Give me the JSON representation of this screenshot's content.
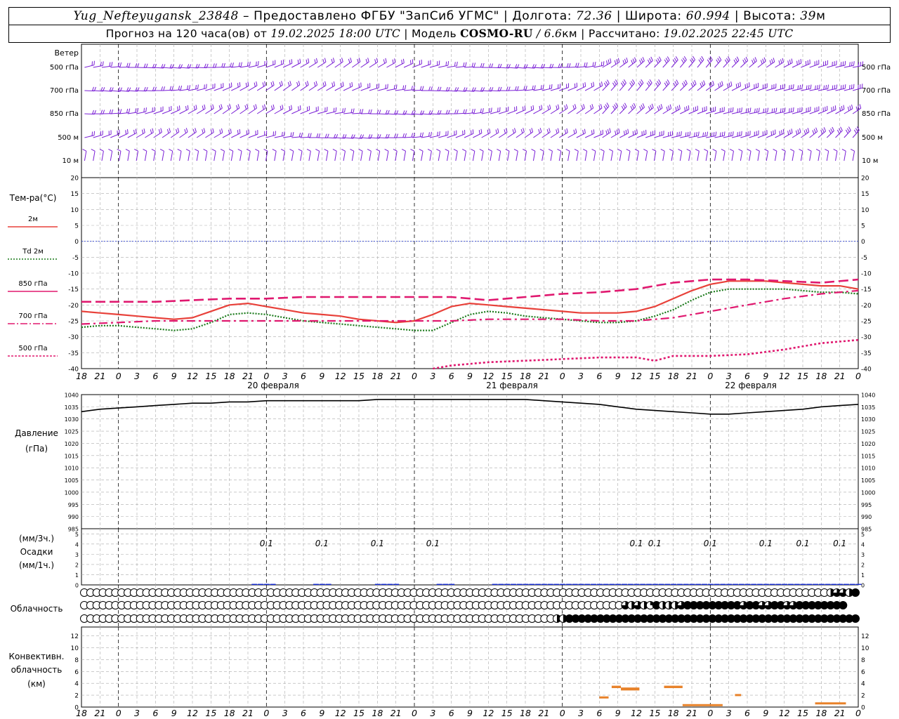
{
  "header": {
    "station": "Yug_Nefteyugansk_23848",
    "provided_prefix": " – Предоставлено ФГБУ \"ЗапСиб УГМС\" | Долгота: ",
    "longitude": "72.36",
    "lat_label": " | Широта: ",
    "latitude": "60.994",
    "alt_label": " | Высота: ",
    "altitude": "39",
    "altitude_unit": "м",
    "forecast_prefix": "Прогноз на 120 часа(ов) от ",
    "forecast_start": "19.02.2025 18:00 UTC",
    "model_label": "  | Модель ",
    "model": "COSMO-RU",
    "resolution": " / 6.6",
    "resolution_unit": "км",
    "computed_label": " | Рассчитано: ",
    "computed": "19.02.2025 22:45 UTC"
  },
  "wind_panel": {
    "title": "Ветер",
    "levels": [
      "500 гПа",
      "700 гПа",
      "850 гПа",
      "500 м",
      "10 м"
    ],
    "barb_color": "#7a1fd6"
  },
  "time_axis": {
    "hour_labels": [
      "18",
      "21",
      "0",
      "3",
      "6",
      "9",
      "12",
      "15",
      "18",
      "21",
      "0",
      "3",
      "6",
      "9",
      "12",
      "15",
      "18",
      "21",
      "0",
      "3",
      "6",
      "9",
      "12",
      "15",
      "18",
      "21",
      "0",
      "3",
      "6",
      "9",
      "12",
      "15",
      "18",
      "21",
      "0",
      "3",
      "6",
      "9",
      "12",
      "15",
      "18",
      "21",
      "0"
    ],
    "day_labels": [
      "20 февраля",
      "21 февраля",
      "22 февраля"
    ]
  },
  "temp_panel": {
    "title": "Тем-ра(°C)",
    "legend": [
      {
        "label": "2м",
        "color": "#e8413a",
        "dash": "solid"
      },
      {
        "label": "Td 2м",
        "color": "#1a7a1a",
        "dash": "dotted"
      },
      {
        "label": "850 гПа",
        "color": "#e0186f",
        "dash": "long"
      },
      {
        "label": "700 гПа",
        "color": "#e0186f",
        "dash": "dashdot"
      },
      {
        "label": "500 гПа",
        "color": "#e0186f",
        "dash": "short"
      }
    ],
    "y_ticks": [
      "20",
      "15",
      "10",
      "5",
      "0",
      "-5",
      "-10",
      "-15",
      "-20",
      "-25",
      "-30",
      "-35",
      "-40"
    ]
  },
  "pressure_panel": {
    "title": "Давление",
    "unit": "(гПа)",
    "y_ticks": [
      "1040",
      "1035",
      "1030",
      "1025",
      "1020",
      "1015",
      "1010",
      "1005",
      "1000",
      "995",
      "990",
      "985"
    ]
  },
  "precip_panel": {
    "unit_3h": "(мм/3ч.)",
    "title": "Осадки",
    "unit_1h": "(мм/1ч.)",
    "y_ticks": [
      "5",
      "4",
      "3",
      "2",
      "1",
      "0"
    ],
    "labels": [
      {
        "hour": 30,
        "text": "0.1"
      },
      {
        "hour": 39,
        "text": "0.1"
      },
      {
        "hour": 48,
        "text": "0.1"
      },
      {
        "hour": 57,
        "text": "0.1"
      },
      {
        "hour": 90,
        "text": "0.1"
      },
      {
        "hour": 93,
        "text": "0.1"
      },
      {
        "hour": 102,
        "text": "0.1"
      },
      {
        "hour": 111,
        "text": "0.1"
      },
      {
        "hour": 117,
        "text": "0.1"
      },
      {
        "hour": 123,
        "text": "0.1"
      }
    ],
    "bar_color": "#1a2fd6"
  },
  "cloud_panel": {
    "title": "Облачность"
  },
  "conv_panel": {
    "title_1": "Конвективн.",
    "title_2": "облачность",
    "unit": "(км)",
    "y_ticks": [
      "12",
      "10",
      "8",
      "6",
      "4",
      "2",
      "0"
    ],
    "bar_color": "#e8822a"
  },
  "chart_data": {
    "type": "line",
    "x_unit": "hours from 19.02.2025 18:00 UTC",
    "xlim": [
      0,
      126
    ],
    "series": [
      {
        "name": "2м",
        "panel": "temperature",
        "unit": "°C",
        "x": [
          0,
          3,
          6,
          9,
          12,
          15,
          18,
          21,
          24,
          27,
          30,
          33,
          36,
          39,
          42,
          45,
          48,
          51,
          54,
          57,
          60,
          63,
          66,
          69,
          72,
          75,
          78,
          81,
          84,
          87,
          90,
          93,
          96,
          99,
          102,
          105,
          108,
          111,
          114,
          117,
          120,
          123,
          126
        ],
        "values": [
          -22,
          -22.5,
          -23,
          -23.5,
          -24,
          -24.5,
          -24,
          -22,
          -20,
          -19.5,
          -20.5,
          -21.5,
          -22.5,
          -23,
          -23.5,
          -24.5,
          -25,
          -25.5,
          -25,
          -23,
          -20.5,
          -19.5,
          -20,
          -20.5,
          -21,
          -21.5,
          -22,
          -22.5,
          -22.5,
          -22.5,
          -22,
          -20.5,
          -18,
          -15.5,
          -13.5,
          -12.5,
          -12.5,
          -12.5,
          -13,
          -13.5,
          -14,
          -14,
          -15
        ]
      },
      {
        "name": "Td 2м",
        "panel": "temperature",
        "unit": "°C",
        "x": [
          0,
          3,
          6,
          9,
          12,
          15,
          18,
          21,
          24,
          27,
          30,
          33,
          36,
          39,
          42,
          45,
          48,
          51,
          54,
          57,
          60,
          63,
          66,
          69,
          72,
          75,
          78,
          81,
          84,
          87,
          90,
          93,
          96,
          99,
          102,
          105,
          108,
          111,
          114,
          117,
          120,
          123,
          126
        ],
        "values": [
          -27,
          -26.5,
          -26.5,
          -27,
          -27.5,
          -28,
          -27.5,
          -25.5,
          -23,
          -22.5,
          -23,
          -24,
          -25,
          -25.5,
          -26,
          -26.5,
          -27,
          -27.5,
          -28,
          -28,
          -25.5,
          -23,
          -22,
          -22.5,
          -23.5,
          -24,
          -24.5,
          -25,
          -25.5,
          -25.5,
          -25,
          -23.5,
          -21.5,
          -18.5,
          -16,
          -15,
          -15,
          -15,
          -15,
          -15.5,
          -16,
          -16,
          -16.5
        ]
      },
      {
        "name": "850 гПа",
        "panel": "temperature",
        "unit": "°C",
        "x": [
          0,
          6,
          12,
          18,
          24,
          30,
          36,
          42,
          48,
          54,
          60,
          66,
          72,
          78,
          84,
          90,
          96,
          102,
          108,
          114,
          120,
          126
        ],
        "values": [
          -19,
          -19,
          -19,
          -18.5,
          -18,
          -18,
          -17.5,
          -17.5,
          -17.5,
          -17.5,
          -17.5,
          -18.5,
          -17.5,
          -16.5,
          -16,
          -15,
          -13,
          -12,
          -12,
          -12.5,
          -13,
          -12
        ]
      },
      {
        "name": "700 гПа",
        "panel": "temperature",
        "unit": "°C",
        "x": [
          0,
          6,
          12,
          18,
          24,
          30,
          36,
          42,
          48,
          54,
          60,
          66,
          72,
          78,
          84,
          90,
          96,
          102,
          108,
          114,
          120,
          126
        ],
        "values": [
          -26,
          -25.5,
          -25,
          -25,
          -25,
          -25,
          -25,
          -25,
          -25,
          -25,
          -25,
          -24.5,
          -24.5,
          -24.5,
          -25,
          -25,
          -24,
          -22,
          -20,
          -18,
          -16.5,
          -15.5
        ]
      },
      {
        "name": "500 гПа",
        "panel": "temperature",
        "unit": "°C",
        "x": [
          57,
          60,
          66,
          72,
          78,
          84,
          90,
          93,
          96,
          102,
          108,
          114,
          120,
          126
        ],
        "values": [
          -40,
          -39,
          -38,
          -37.5,
          -37,
          -36.5,
          -36.5,
          -37.5,
          -36,
          -36,
          -35.5,
          -34,
          -32,
          -31
        ]
      },
      {
        "name": "Давление",
        "panel": "pressure",
        "unit": "гПа",
        "x": [
          0,
          3,
          6,
          9,
          12,
          15,
          18,
          21,
          24,
          27,
          30,
          33,
          36,
          39,
          42,
          45,
          48,
          51,
          54,
          57,
          60,
          63,
          66,
          69,
          72,
          75,
          78,
          81,
          84,
          87,
          90,
          93,
          96,
          99,
          102,
          105,
          108,
          111,
          114,
          117,
          120,
          123,
          126
        ],
        "values": [
          1033,
          1034,
          1034.5,
          1035,
          1035.5,
          1036,
          1036.5,
          1036.5,
          1037,
          1037,
          1037.5,
          1037.5,
          1037.5,
          1037.5,
          1037.5,
          1037.5,
          1038,
          1038,
          1038,
          1038,
          1038,
          1038,
          1038,
          1038,
          1038,
          1037.5,
          1037,
          1036.5,
          1036,
          1035,
          1034,
          1033.5,
          1033,
          1032.5,
          1032,
          1032,
          1032.5,
          1033,
          1033.5,
          1034,
          1035,
          1035.5,
          1036
        ]
      }
    ],
    "precip_bars": {
      "unit": "мм/1ч.",
      "x": [
        28,
        29,
        30,
        31,
        38,
        39,
        40,
        48,
        49,
        50,
        51,
        58,
        59,
        60,
        67,
        68,
        69,
        70,
        71,
        72,
        73,
        74,
        75,
        76,
        77,
        78,
        79,
        80,
        81,
        82,
        83,
        84,
        85,
        86,
        87,
        88,
        89,
        90,
        91,
        92,
        93,
        94,
        95,
        96,
        97,
        98,
        99,
        100,
        101,
        102,
        103,
        104,
        105,
        106,
        107,
        108,
        109,
        110,
        111,
        112,
        113,
        114,
        115,
        116,
        117,
        118,
        119,
        120,
        121,
        122,
        123,
        124,
        125,
        126
      ],
      "values": [
        0.1,
        0.1,
        0.1,
        0.1,
        0.1,
        0.1,
        0.1,
        0.1,
        0.1,
        0.1,
        0.1,
        0.1,
        0.1,
        0.1,
        0.1,
        0.1,
        0.1,
        0.1,
        0.1,
        0.1,
        0.1,
        0.1,
        0.1,
        0.1,
        0.1,
        0.1,
        0.1,
        0.1,
        0.1,
        0.1,
        0.1,
        0.1,
        0.1,
        0.1,
        0.1,
        0.1,
        0.1,
        0.1,
        0.1,
        0.1,
        0.1,
        0.1,
        0.1,
        0.1,
        0.1,
        0.1,
        0.1,
        0.1,
        0.1,
        0.1,
        0.1,
        0.1,
        0.1,
        0.1,
        0.1,
        0.1,
        0.1,
        0.1,
        0.1,
        0.1,
        0.1,
        0.1,
        0.1,
        0.1,
        0.1,
        0.1,
        0.1,
        0.1,
        0.1,
        0.1,
        0.1,
        0.1,
        0.1,
        0.1
      ]
    },
    "convective_cloud": {
      "unit": "км",
      "segments": [
        {
          "x0": 84,
          "x1": 85.5,
          "base": 1.5,
          "top": 1.8
        },
        {
          "x0": 86,
          "x1": 87.5,
          "base": 3.2,
          "top": 3.6
        },
        {
          "x0": 87.5,
          "x1": 90.5,
          "base": 2.8,
          "top": 3.3
        },
        {
          "x0": 94.5,
          "x1": 97.5,
          "base": 3.2,
          "top": 3.6
        },
        {
          "x0": 97.5,
          "x1": 104,
          "base": 0.3,
          "top": 0.5
        },
        {
          "x0": 106,
          "x1": 107,
          "base": 2.0,
          "top": 2.2
        },
        {
          "x0": 119,
          "x1": 124,
          "base": 0.6,
          "top": 0.8
        }
      ]
    },
    "cloud_cover_rows": [
      {
        "level": "upper",
        "octas": [
          0,
          0,
          0,
          0,
          0,
          0,
          0,
          0,
          0,
          0,
          0,
          0,
          0,
          0,
          0,
          0,
          0,
          0,
          0,
          0,
          0,
          0,
          0,
          0,
          0,
          0,
          0,
          0,
          0,
          0,
          0,
          0,
          0,
          0,
          0,
          0,
          0,
          0,
          0,
          0,
          0,
          0,
          0,
          0,
          0,
          0,
          0,
          0,
          0,
          0,
          0,
          0,
          0,
          0,
          0,
          0,
          0,
          0,
          0,
          0,
          0,
          0,
          0,
          0,
          0,
          0,
          0,
          0,
          0,
          0,
          0,
          0,
          0,
          0,
          0,
          0,
          0,
          0,
          0,
          0,
          0,
          0,
          0,
          0,
          0,
          0,
          0,
          0,
          0,
          0,
          0,
          0,
          0,
          0,
          0,
          0,
          0,
          0,
          0,
          0,
          0,
          0,
          0,
          0,
          0,
          0,
          0,
          0,
          0,
          0,
          0,
          0,
          0,
          0,
          0,
          0,
          0,
          0,
          0,
          0,
          4,
          6,
          6,
          4,
          8
        ]
      },
      {
        "level": "middle",
        "octas": [
          0,
          0,
          0,
          0,
          0,
          0,
          0,
          0,
          0,
          0,
          0,
          0,
          0,
          0,
          0,
          0,
          0,
          0,
          0,
          0,
          0,
          0,
          0,
          0,
          0,
          0,
          0,
          0,
          0,
          0,
          0,
          0,
          0,
          0,
          0,
          0,
          0,
          0,
          0,
          0,
          0,
          0,
          0,
          0,
          0,
          0,
          0,
          0,
          0,
          0,
          0,
          0,
          0,
          0,
          0,
          0,
          0,
          0,
          0,
          0,
          0,
          0,
          0,
          0,
          0,
          0,
          0,
          0,
          0,
          0,
          0,
          0,
          0,
          0,
          0,
          0,
          0,
          0,
          0,
          0,
          0,
          0,
          0,
          0,
          0,
          0,
          0,
          6,
          4,
          6,
          4,
          2,
          8,
          4,
          4,
          4,
          6,
          8,
          8,
          8,
          8,
          8,
          8,
          8,
          8,
          8,
          6,
          8,
          8,
          6,
          6,
          8,
          8,
          6,
          6,
          8,
          8,
          8,
          8,
          8,
          8,
          8,
          8
        ]
      },
      {
        "level": "lower",
        "octas": [
          0,
          0,
          0,
          0,
          0,
          0,
          0,
          0,
          0,
          0,
          0,
          0,
          0,
          0,
          0,
          0,
          0,
          0,
          0,
          0,
          0,
          0,
          0,
          0,
          0,
          0,
          0,
          0,
          0,
          0,
          0,
          0,
          0,
          0,
          0,
          0,
          0,
          0,
          0,
          0,
          0,
          0,
          0,
          0,
          0,
          0,
          0,
          0,
          0,
          0,
          0,
          0,
          0,
          0,
          0,
          0,
          0,
          0,
          0,
          0,
          0,
          0,
          0,
          0,
          0,
          0,
          0,
          0,
          0,
          0,
          0,
          0,
          0,
          0,
          0,
          0,
          4,
          4,
          8,
          8,
          8,
          8,
          8,
          8,
          8,
          8,
          8,
          8,
          8,
          8,
          8,
          8,
          8,
          8,
          8,
          8,
          8,
          8,
          8,
          8,
          8,
          8,
          8,
          8,
          8,
          8,
          8,
          8,
          8,
          8,
          8,
          8,
          8,
          8,
          8,
          8,
          8,
          8,
          8,
          8,
          8,
          8,
          8,
          8,
          8
        ]
      }
    ],
    "ylim": {
      "temperature": [
        -40,
        20
      ],
      "pressure": [
        985,
        1040
      ],
      "precip": [
        0,
        5
      ],
      "convective": [
        0,
        13
      ]
    }
  }
}
